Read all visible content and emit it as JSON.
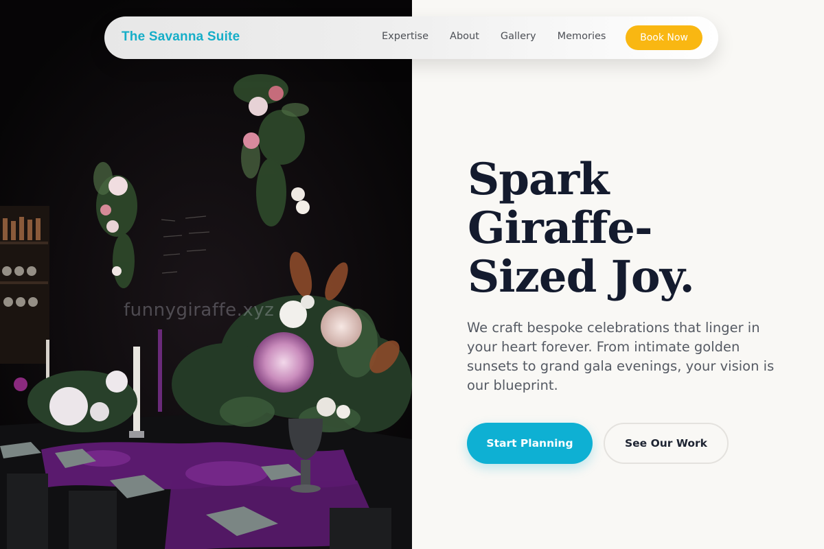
{
  "nav": {
    "brand": "The Savanna Suite",
    "links": [
      "Expertise",
      "About",
      "Gallery",
      "Memories"
    ],
    "cta": "Book Now"
  },
  "hero": {
    "title_lines": [
      "Spark",
      "Giraffe-",
      "Sized Joy."
    ],
    "description": "We craft bespoke celebrations that linger in your heart forever. From intimate golden sunsets to grand gala evenings, your vision is our blueprint.",
    "primary_button": "Start Planning",
    "secondary_button": "See Our Work"
  },
  "photo": {
    "watermark": "funnygiraffe.xyz"
  },
  "colors": {
    "brand": "#16aec8",
    "cta": "#f9b712",
    "primary_button": "#0eb0d3",
    "heading": "#141b2e"
  }
}
